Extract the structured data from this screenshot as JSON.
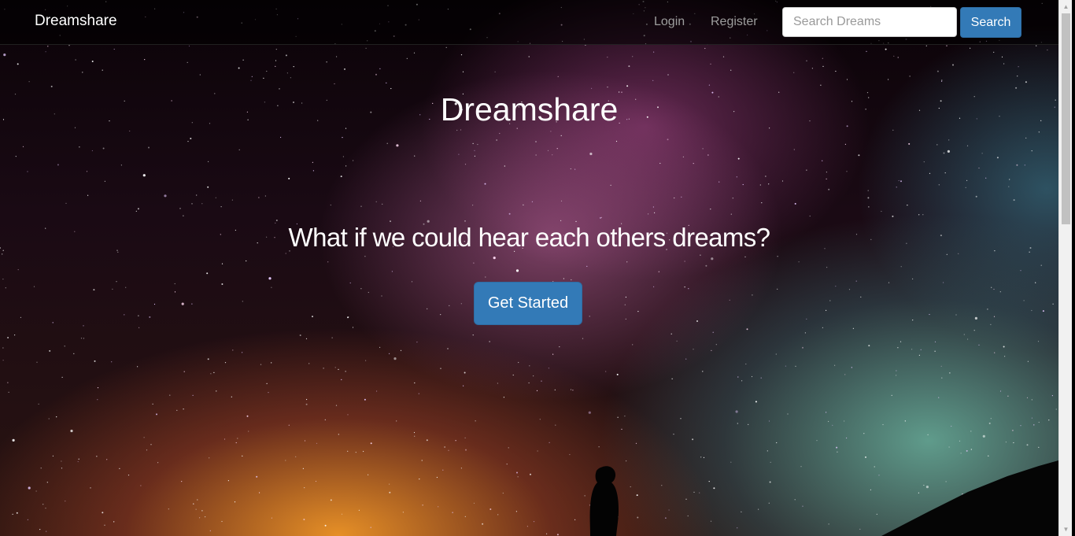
{
  "navbar": {
    "brand": "Dreamshare",
    "links": [
      {
        "label": "Login"
      },
      {
        "label": "Register"
      }
    ],
    "search": {
      "placeholder": "Search Dreams",
      "value": "",
      "button_label": "Search"
    }
  },
  "hero": {
    "title": "Dreamshare",
    "tagline": "What if we could hear each others dreams?",
    "cta_label": "Get Started",
    "background": "starry night sky with milky way and silhouette of person"
  },
  "scrollbar": {
    "up_icon": "arrow-up-icon",
    "down_icon": "arrow-down-icon"
  },
  "colors": {
    "primary": "#337ab7",
    "nav_link": "#9d9d9d",
    "text_light": "#ffffff"
  }
}
